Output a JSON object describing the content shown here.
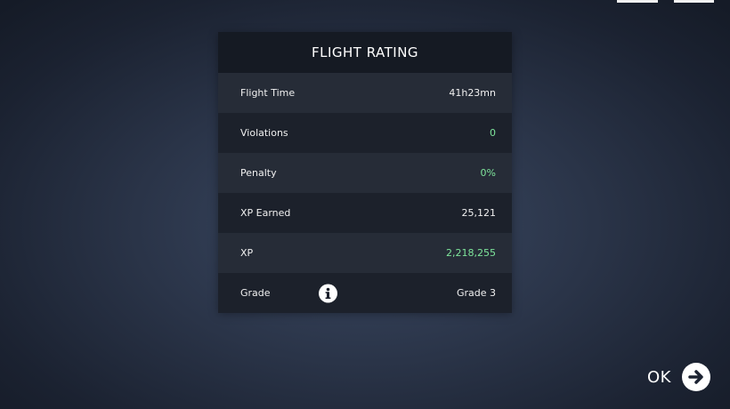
{
  "panel": {
    "title": "FLIGHT RATING",
    "rows": [
      {
        "label": "Flight Time",
        "value": "41h23mn",
        "value_color": "#f0f0f0"
      },
      {
        "label": "Violations",
        "value": "0",
        "value_color": "#7ee59b"
      },
      {
        "label": "Penalty",
        "value": "0%",
        "value_color": "#7ee59b"
      },
      {
        "label": "XP Earned",
        "value": "25,121",
        "value_color": "#f0f0f0"
      },
      {
        "label": "XP",
        "value": "2,218,255",
        "value_color": "#7ee59b"
      },
      {
        "label": "Grade",
        "value": "Grade 3",
        "value_color": "#f0f0f0",
        "icon": "info-icon"
      }
    ]
  },
  "ok_button": {
    "label": "OK",
    "icon": "arrow-right-circle-icon"
  },
  "colors": {
    "accent_green": "#7ee59b",
    "panel_bg": "#1a1f2a"
  }
}
